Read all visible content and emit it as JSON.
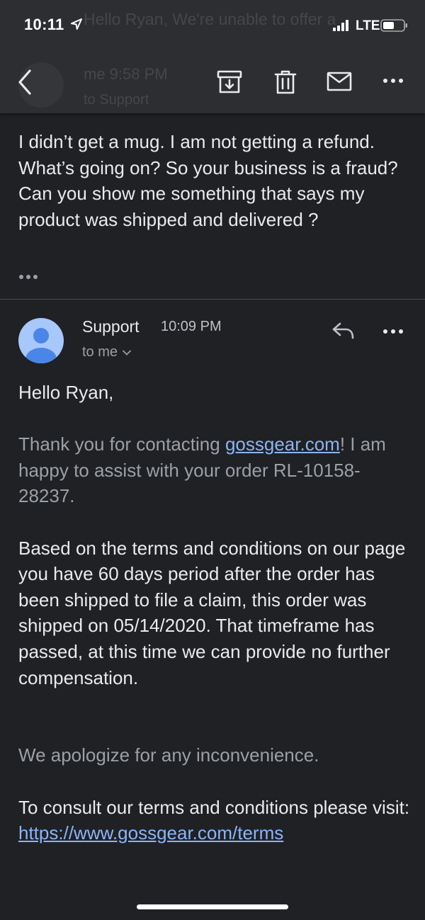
{
  "status_bar": {
    "time": "10:11",
    "network": "LTE"
  },
  "toolbar": {
    "background_header": {
      "preview": "Hello Ryan, We're unable to offer a",
      "sender": "me  9:58 PM",
      "to": "to Support"
    },
    "icons": [
      "back-arrow-icon",
      "archive-icon",
      "trash-icon",
      "mail-icon",
      "more-icon"
    ]
  },
  "quoted_message": {
    "text": "I didn’t get a mug. I am not getting a refund. What’s going on? So your business is a fraud? Can you show me something that says my product was shipped and delivered ?"
  },
  "message": {
    "sender": "Support",
    "time": "10:09 PM",
    "recipient": "to me",
    "greeting": "Hello Ryan,",
    "thanks_prefix": "Thank you for contacting ",
    "thanks_link": "gossgear.com",
    "thanks_suffix": "! I am happy to assist with your order RL-10158-28237.",
    "terms_text": "Based on the terms and conditions on our page you have 60 days period after the order has been shipped to file a claim, this order was shipped on 05/14/2020. That timeframe has passed, at this time we can provide no further compensation.",
    "apology": "We apologize for any inconvenience.",
    "consult_text": "To consult our terms and conditions please visit:",
    "terms_link": "https://www.gossgear.com/terms"
  },
  "colors": {
    "background": "#202124",
    "toolbar": "#2d2e31",
    "text": "#e8eaed",
    "muted_text": "#9aa0a6",
    "link": "#8ab4f8",
    "avatar_bg": "#a8c7fa",
    "avatar_fg": "#4a86e8"
  }
}
